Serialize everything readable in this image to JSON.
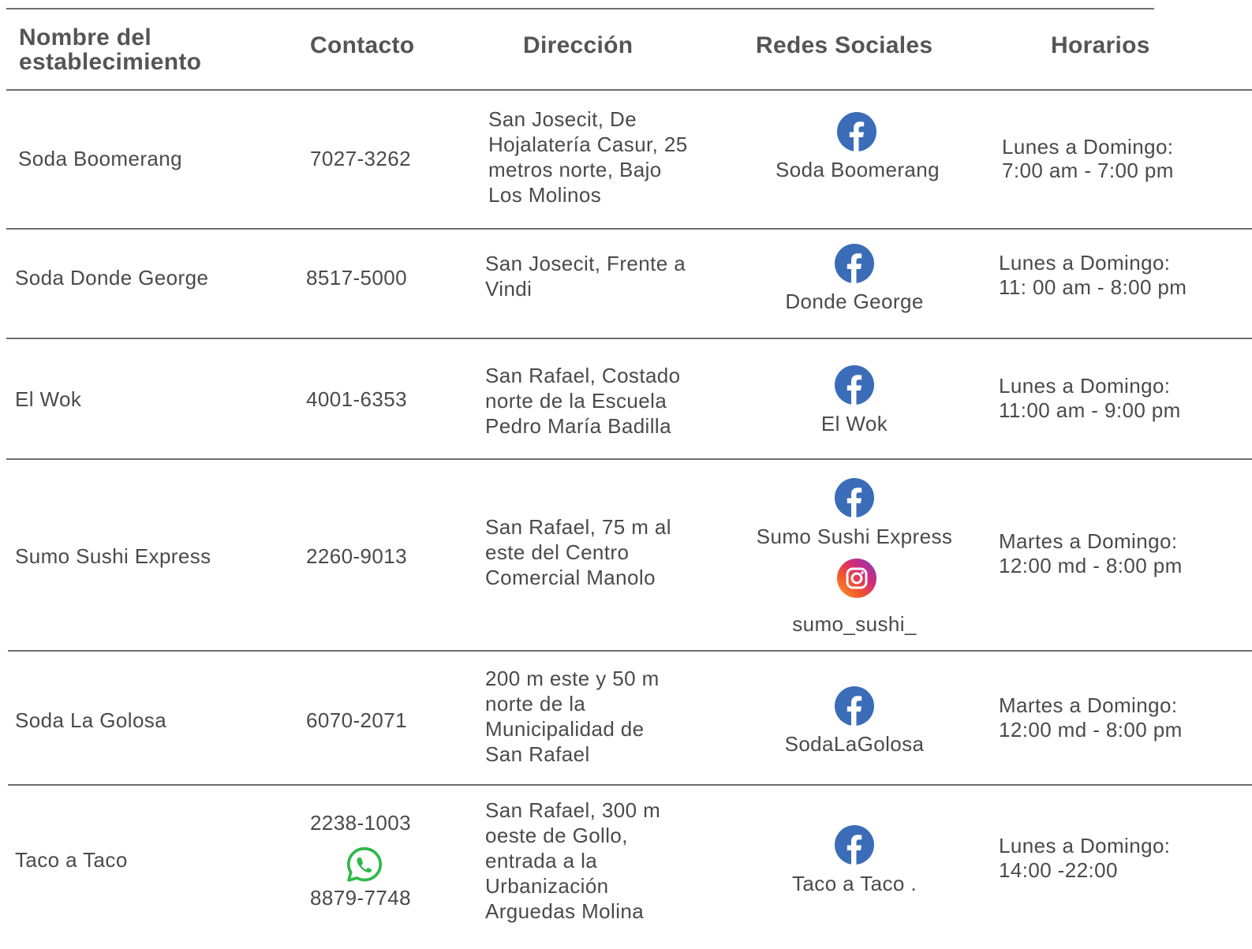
{
  "header": {
    "name": "Nombre del establecimiento",
    "contact": "Contacto",
    "address": "Dirección",
    "social": "Redes Sociales",
    "hours": "Horarios"
  },
  "rows": [
    {
      "name": "Soda Boomerang",
      "contact": "7027-3262",
      "address_lines": [
        "San Josecit, De",
        "Hojalatería Casur, 25",
        "metros norte, Bajo",
        "Los Molinos"
      ],
      "socials": [
        {
          "icon": "facebook-icon",
          "handle": "Soda Boomerang"
        }
      ],
      "hours_days": "Lunes a Domingo:",
      "hours_time": "7:00 am - 7:00 pm"
    },
    {
      "name": "Soda Donde George",
      "contact": "8517-5000",
      "address_lines": [
        "San Josecit, Frente a",
        "Vindi"
      ],
      "socials": [
        {
          "icon": "facebook-icon",
          "handle": "Donde George"
        }
      ],
      "hours_days": "Lunes a Domingo:",
      "hours_time": "11: 00 am  - 8:00 pm"
    },
    {
      "name": "El Wok",
      "contact": "4001-6353",
      "address_lines": [
        "San Rafael, Costado",
        "norte de la Escuela",
        "Pedro María Badilla"
      ],
      "socials": [
        {
          "icon": "facebook-icon",
          "handle": "El Wok"
        }
      ],
      "hours_days": "Lunes a Domingo:",
      "hours_time": "11:00 am - 9:00 pm"
    },
    {
      "name": "Sumo Sushi Express",
      "contact": "2260-9013",
      "address_lines": [
        "San Rafael, 75 m al",
        "este del Centro",
        "Comercial Manolo"
      ],
      "socials": [
        {
          "icon": "facebook-icon",
          "handle": "Sumo Sushi Express"
        },
        {
          "icon": "instagram-icon",
          "handle": "sumo_sushi_"
        }
      ],
      "hours_days": "Martes a Domingo:",
      "hours_time": "12:00 md - 8:00 pm"
    },
    {
      "name": "Soda La Golosa",
      "contact": "6070-2071",
      "address_lines": [
        "200 m este y 50 m",
        "norte de la",
        "Municipalidad de",
        "San Rafael"
      ],
      "socials": [
        {
          "icon": "facebook-icon",
          "handle": "SodaLaGolosa"
        }
      ],
      "hours_days": "Martes a Domingo:",
      "hours_time": "12:00 md - 8:00 pm"
    },
    {
      "name": "Taco a Taco",
      "contact": "2238-1003",
      "contact_whatsapp": "8879-7748",
      "contact_whatsapp_icon": "whatsapp-icon",
      "address_lines": [
        "San Rafael, 300 m",
        "oeste de Gollo,",
        "entrada a la",
        "Urbanización",
        "Arguedas Molina"
      ],
      "socials": [
        {
          "icon": "facebook-icon",
          "handle": "Taco a Taco ."
        }
      ],
      "hours_days": "Lunes a Domingo:",
      "hours_time": "14:00 -22:00"
    }
  ],
  "colors": {
    "facebook": "#3b6cb7",
    "whatsapp": "#2fb84a",
    "text": "#4a4a4a",
    "rule": "#6e6e6e"
  }
}
